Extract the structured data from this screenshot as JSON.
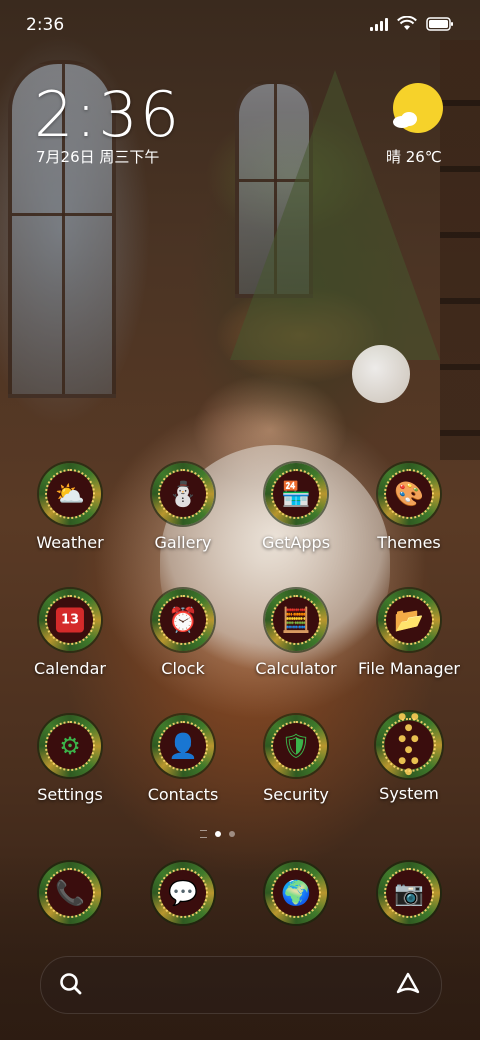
{
  "status_bar": {
    "time": "2:36"
  },
  "clock_widget": {
    "time": "2:36",
    "date": "7月26日 周三下午"
  },
  "weather_widget": {
    "text": "晴 26℃",
    "icon": "sun-cloud-icon"
  },
  "apps": [
    {
      "label": "Weather",
      "icon": "weather-icon"
    },
    {
      "label": "Gallery",
      "icon": "gallery-icon"
    },
    {
      "label": "GetApps",
      "icon": "getapps-icon"
    },
    {
      "label": "Themes",
      "icon": "themes-icon"
    },
    {
      "label": "Calendar",
      "icon": "calendar-icon",
      "badge": "13"
    },
    {
      "label": "Clock",
      "icon": "alarm-clock-icon"
    },
    {
      "label": "Calculator",
      "icon": "calculator-icon"
    },
    {
      "label": "File Manager",
      "icon": "folder-icon"
    },
    {
      "label": "Settings",
      "icon": "gear-icon"
    },
    {
      "label": "Contacts",
      "icon": "contacts-icon"
    },
    {
      "label": "Security",
      "icon": "shield-icon"
    },
    {
      "label": "System",
      "icon": "folder-grid-icon"
    }
  ],
  "dock": [
    {
      "icon": "phone-icon"
    },
    {
      "icon": "messages-icon"
    },
    {
      "icon": "browser-globe-icon"
    },
    {
      "icon": "camera-icon"
    }
  ]
}
